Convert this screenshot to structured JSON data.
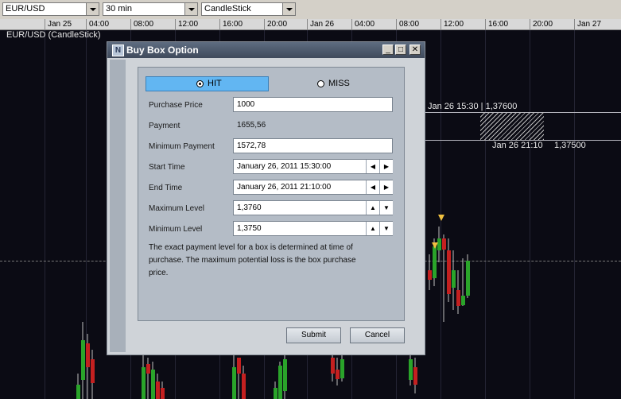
{
  "toolbar": {
    "pair": "EUR/USD",
    "interval": "30 min",
    "chart_type": "CandleStick"
  },
  "time_axis": [
    "Jan 25",
    "04:00",
    "08:00",
    "12:00",
    "16:00",
    "20:00",
    "Jan 26",
    "04:00",
    "08:00",
    "12:00",
    "16:00",
    "20:00",
    "Jan 27"
  ],
  "chart": {
    "symbol_label": "EUR/USD (CandleStick)",
    "level_high_label": "Jan 26 15:30 | 1,37600",
    "level_low_time": "Jan 26 21:10",
    "level_low_value": "1,37500"
  },
  "colors": {
    "up_candle": "#2aa42a",
    "down_candle": "#c42020",
    "hit_button": "#62b6f2",
    "background": "#0b0b14"
  },
  "dialog": {
    "title": "Buy Box Option",
    "hit_label": "HIT",
    "miss_label": "MISS",
    "selected": "HIT",
    "purchase_price_label": "Purchase Price",
    "purchase_price_value": "1000",
    "payment_label": "Payment",
    "payment_value": "1655,56",
    "minimum_payment_label": "Minimum Payment",
    "minimum_payment_value": "1572,78",
    "start_time_label": "Start Time",
    "start_time_value": "January 26, 2011  15:30:00",
    "end_time_label": "End Time",
    "end_time_value": "January 26, 2011  21:10:00",
    "maximum_level_label": "Maximum Level",
    "maximum_level_value": "1,3760",
    "minimum_level_label": "Minimum Level",
    "minimum_level_value": "1,3750",
    "note": "The exact payment level for a box is determined at time of purchase. The maximum potential loss is the box purchase price.",
    "submit_label": "Submit",
    "cancel_label": "Cancel"
  }
}
